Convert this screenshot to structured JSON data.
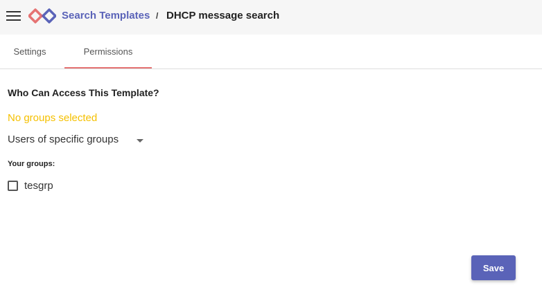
{
  "header": {
    "menu_icon": "hamburger-icon",
    "logo_icon": "app-logo-icon",
    "breadcrumb_link": "Search Templates",
    "breadcrumb_separator": "/",
    "breadcrumb_current": "DHCP message search"
  },
  "tabs": [
    {
      "label": "Settings",
      "active": false
    },
    {
      "label": "Permissions",
      "active": true
    }
  ],
  "permissions": {
    "title": "Who Can Access This Template?",
    "warning": "No groups selected",
    "access_select": {
      "value": "Users of specific groups",
      "icon": "caret-down-icon"
    },
    "groups_label": "Your groups:",
    "groups": [
      {
        "name": "tesgrp",
        "checked": false
      }
    ]
  },
  "actions": {
    "save_label": "Save"
  },
  "colors": {
    "accent": "#5a63b8",
    "tab_underline": "#e57373",
    "warning": "#f5c000",
    "topbar_bg": "#f6f6f6"
  }
}
